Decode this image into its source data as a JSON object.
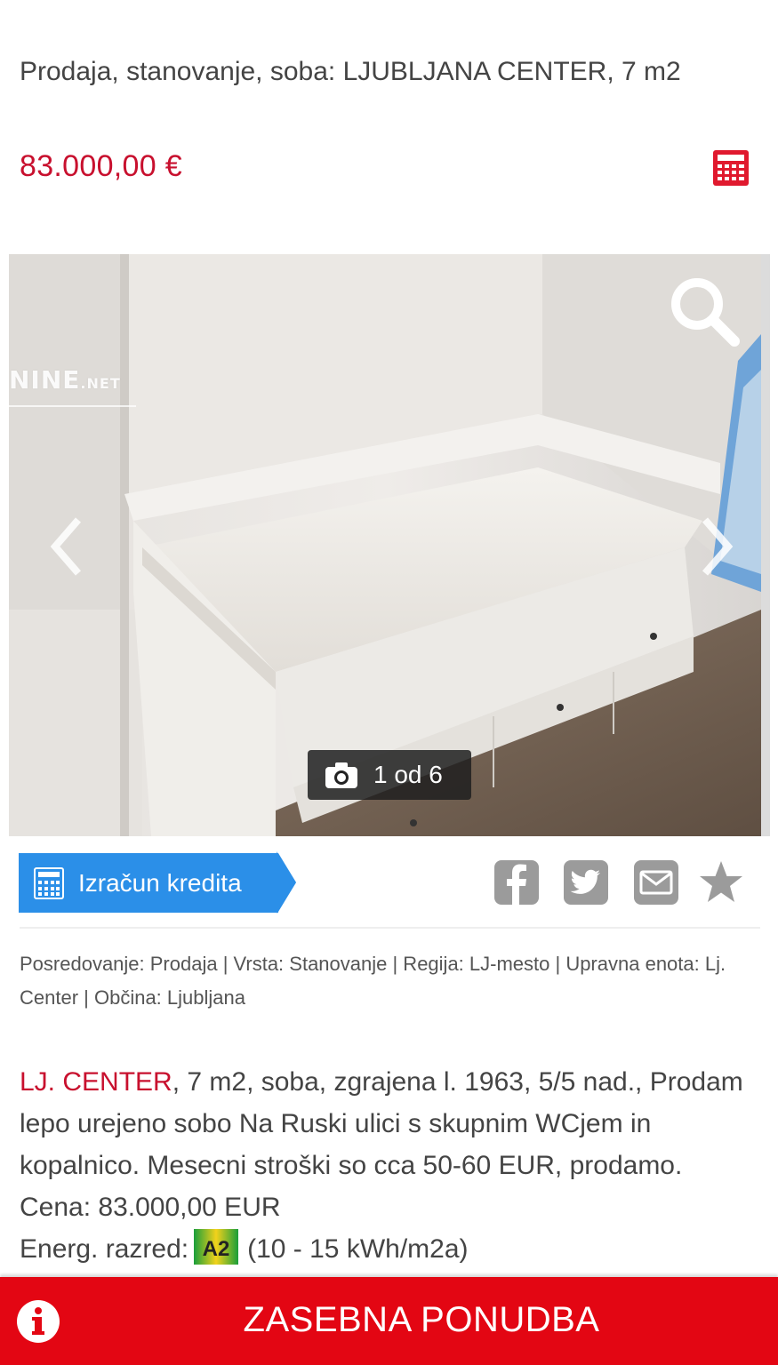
{
  "listing": {
    "title": "Prodaja, stanovanje, soba: LJUBLJANA CENTER, 7 m2",
    "price": "83.000,00 €"
  },
  "gallery": {
    "watermark_main": "NINE",
    "watermark_suffix": ".NET",
    "counter": "1 od 6"
  },
  "actions": {
    "credit_label": "Izračun kredita",
    "share_icons": [
      "facebook-icon",
      "twitter-icon",
      "email-icon",
      "star-icon"
    ]
  },
  "meta": "Posredovanje: Prodaja | Vrsta: Stanovanje | Regija: LJ-mesto | Upravna enota: Lj. Center | Občina: Ljubljana",
  "description": {
    "location": "LJ. CENTER",
    "text": ", 7 m2, soba, zgrajena l. 1963, 5/5 nad., Prodam lepo urejeno sobo Na Ruski ulici s skupnim WCjem in kopalnico. Mesecni stroški so cca 50-60 EUR, prodamo. Cena: 83.000,00 EUR",
    "energy_label": "Energ. razred:",
    "energy_class": "A2",
    "energy_range": "(10 - 15 kWh/m2a)"
  },
  "bottom_bar": {
    "label": "ZASEBNA PONUDBA"
  },
  "colors": {
    "accent_red": "#c8102e",
    "bar_red": "#e30613",
    "button_blue": "#2b8fe8"
  }
}
